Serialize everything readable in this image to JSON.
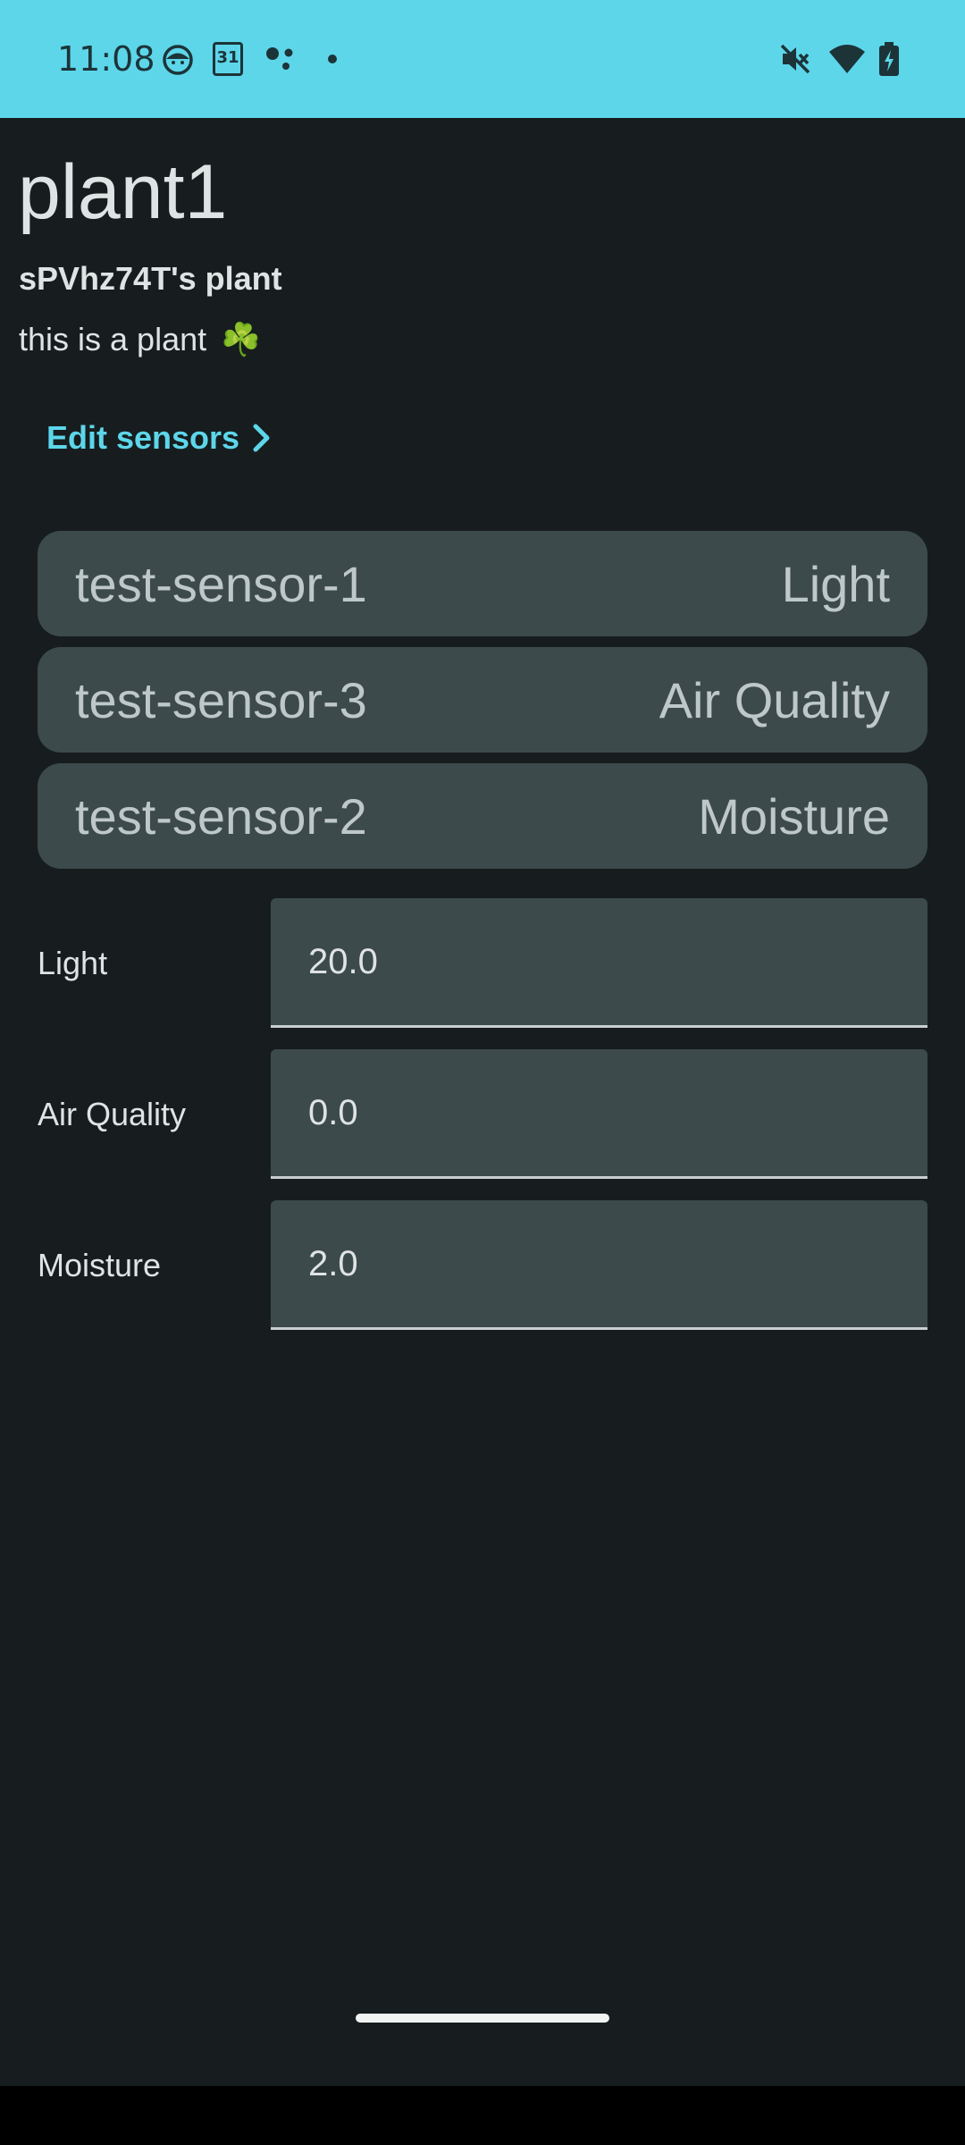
{
  "status_bar": {
    "time": "11:08",
    "calendar_day": "31",
    "icons": [
      "face-icon",
      "calendar-icon",
      "assistant-dots-icon",
      "notification-dot-icon",
      "mute-icon",
      "wifi-icon",
      "battery-charging-icon"
    ]
  },
  "plant": {
    "name": "plant1",
    "owner": "sPVhz74T's plant",
    "description": "this is a plant",
    "description_emoji": "☘️"
  },
  "edit_sensors": {
    "label": "Edit sensors",
    "icon": "chevron-right-icon"
  },
  "sensors": [
    {
      "id": "test-sensor-1",
      "type": "Light"
    },
    {
      "id": "test-sensor-3",
      "type": "Air Quality"
    },
    {
      "id": "test-sensor-2",
      "type": "Moisture"
    }
  ],
  "readings": [
    {
      "label": "Light",
      "value": "20.0"
    },
    {
      "label": "Air Quality",
      "value": "0.0"
    },
    {
      "label": "Moisture",
      "value": "2.0"
    }
  ],
  "colors": {
    "status_bar": "#5dd6ea",
    "background": "#171d1e",
    "accent": "#5dd6ea",
    "card": "#3c4a4b"
  }
}
